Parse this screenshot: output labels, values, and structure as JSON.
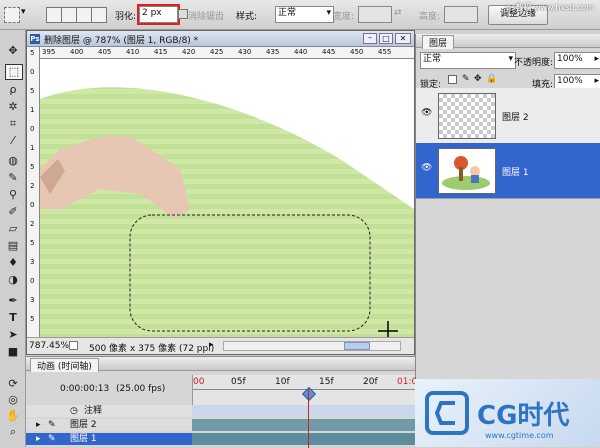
{
  "options_bar": {
    "feather_label": "羽化:",
    "feather_value": "2 px",
    "antialias_label": "消除锯齿",
    "style_label": "样式:",
    "style_value": "正常",
    "width_label": "宽度:",
    "height_label": "高度:",
    "refine_edge_label": "调整边缘"
  },
  "document": {
    "title": "删除图层 @ 787% (图层 1, RGB/8) *",
    "ruler_top": [
      "395",
      "400",
      "405",
      "410",
      "415",
      "420",
      "425",
      "430",
      "435",
      "440",
      "445",
      "450",
      "455"
    ],
    "ruler_left": [
      "5",
      "0",
      "5",
      "1",
      "0",
      "1",
      "5",
      "2",
      "0",
      "2",
      "5",
      "3",
      "0",
      "3",
      "5"
    ],
    "zoom": "787.45%",
    "doc_info": "500 像素 x 375 像素 (72 ppi)"
  },
  "layers_panel": {
    "tab": "图层",
    "blend_mode": "正常",
    "opacity_label": "不透明度:",
    "opacity_value": "100%",
    "lock_label": "锁定:",
    "fill_label": "填充:",
    "fill_value": "100%",
    "layers": [
      {
        "name": "图层 2",
        "selected": false
      },
      {
        "name": "图层 1",
        "selected": true
      }
    ]
  },
  "timeline": {
    "tab": "动画 (时间轴)",
    "timecode": "0:00:00:13",
    "fps": "(25.00 fps)",
    "ticks": [
      "00",
      "05f",
      "10f",
      "15f",
      "20f",
      "01:0"
    ],
    "comment_label": "注释",
    "layers": [
      "图层 2",
      "图层 1"
    ]
  },
  "watermark": {
    "top": "ps教程 www.hxsd.com",
    "brand": "CG时代",
    "bottom": "www.cgtime.com"
  },
  "colors": {
    "selection_blue": "#3366cc",
    "canvas_green": "#c8e6a0",
    "highlight_red": "#e02020",
    "playhead_red": "#d42020"
  }
}
